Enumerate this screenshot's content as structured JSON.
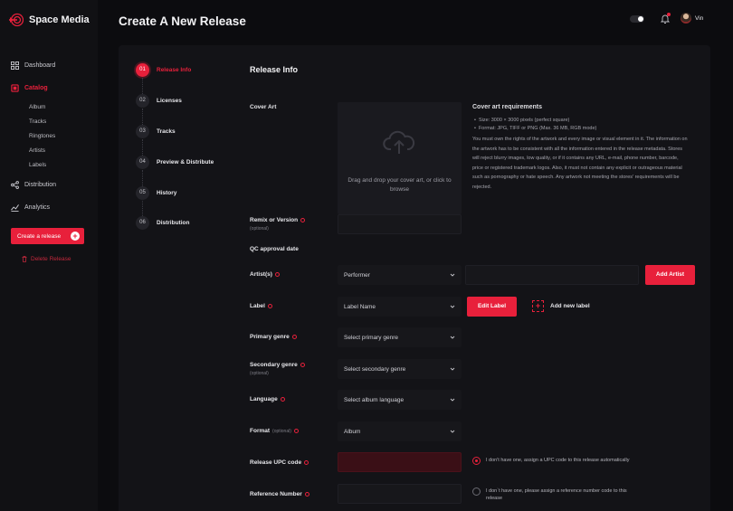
{
  "brand": {
    "name": "Space Media"
  },
  "sidebar": {
    "items": [
      {
        "label": "Dashboard",
        "icon": "grid-icon"
      },
      {
        "label": "Catalog",
        "icon": "catalog-icon",
        "active": true
      },
      {
        "label": "Distribution",
        "icon": "share-icon"
      },
      {
        "label": "Analytics",
        "icon": "chart-icon"
      }
    ],
    "catalog_sub": [
      "Album",
      "Tracks",
      "Ringtones",
      "Artists",
      "Labels"
    ],
    "create_button": "Create a release",
    "delete_link": "Delete Release"
  },
  "header": {
    "title": "Create A New Release",
    "user_name": "Vin"
  },
  "steps": [
    {
      "num": "01",
      "label": "Release Info",
      "active": true
    },
    {
      "num": "02",
      "label": "Licenses"
    },
    {
      "num": "03",
      "label": "Tracks"
    },
    {
      "num": "04",
      "label": "Preview & Distribute"
    },
    {
      "num": "05",
      "label": "History"
    },
    {
      "num": "06",
      "label": "Distribution"
    }
  ],
  "form": {
    "section_title": "Release Info",
    "cover_art_label": "Cover Art",
    "dropzone_text": "Drag and drop your cover art, or click to browse",
    "requirements": {
      "title": "Cover art requirements",
      "bullets": [
        "Size: 3000 × 3000 pixels (perfect square)",
        "Format: JPG, TIFF or PNG (Max. 36 MB, RGB mode)"
      ],
      "paragraph": "You must own the rights of the artwork and every image or visual element in it. The information on the artwork has to be consistent with all the information entered in the release metadata. Stores will reject blurry images, low quality, or if it contains any URL, e-mail, phone number, barcode, price or registered trademark logos. Also, it must not contain any explicit or outrageous material such as pornography or hate speech. Any artwork not meeting the stores' requirements will be rejected."
    },
    "remix_label": "Remix or Version",
    "remix_optional": "(optional)",
    "qc_label": "QC approval date",
    "artist_label": "Artist(s)",
    "artist_value": "Performer",
    "add_artist_button": "Add Artist",
    "label_label": "Label",
    "label_value": "Label Name",
    "edit_label_button": "Edit Label",
    "add_new_label": "Add new label",
    "primary_genre_label": "Primary genre",
    "primary_genre_value": "Select primary genre",
    "secondary_genre_label": "Secondary genre",
    "secondary_genre_optional": "(optional)",
    "secondary_genre_value": "Select secondary genre",
    "language_label": "Language",
    "language_value": "Select album language",
    "format_label": "Format",
    "format_optional": "(optional)",
    "format_value": "Album",
    "upc_label": "Release UPC code",
    "upc_radio_text": "I don't have one, assign a UPC code to this release automatically",
    "reference_label": "Reference Number",
    "reference_radio_text": "I don`t have one, please assign a reference number code to this release"
  },
  "colors": {
    "accent": "#e8203b",
    "background": "#0c0c0f",
    "panel": "#131317"
  }
}
